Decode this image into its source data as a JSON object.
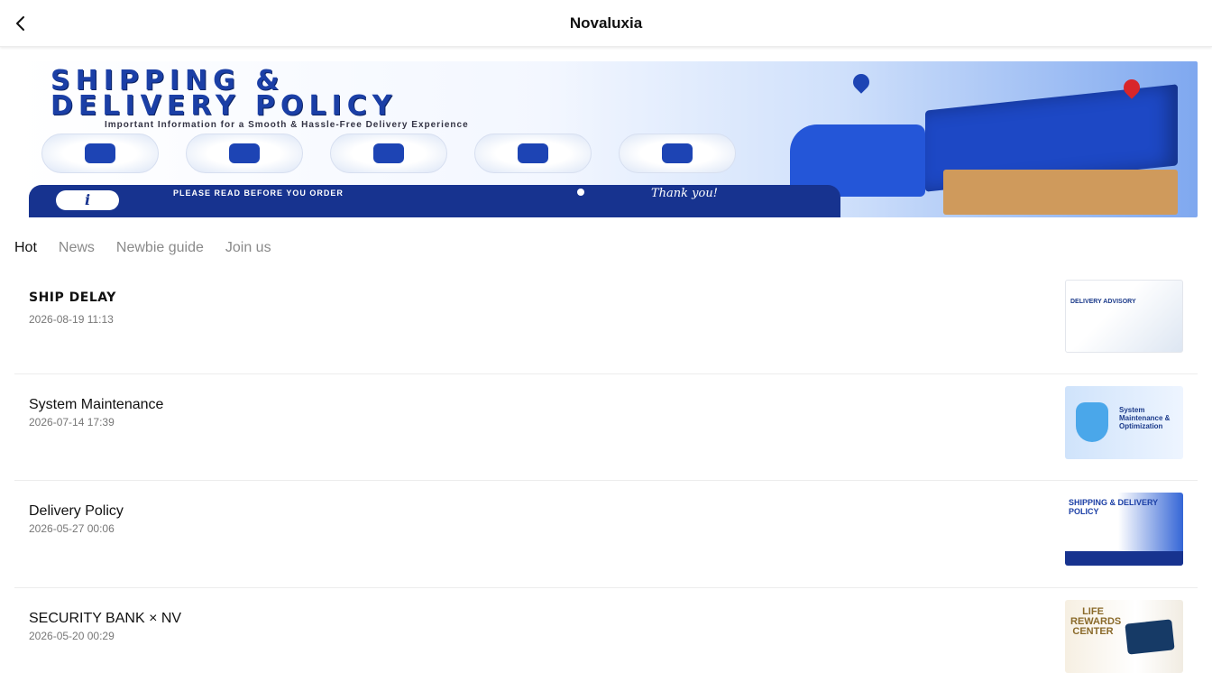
{
  "header": {
    "title": "Novaluxia",
    "back_icon": "chevron-left-icon"
  },
  "banner": {
    "headline_line1": "SHIPPING &",
    "headline_line2": "DELIVERY POLICY",
    "subtitle": "Important Information for a Smooth & Hassle-Free Delivery Experience",
    "notice": "PLEASE READ BEFORE YOU ORDER",
    "thanks": "Thank you!",
    "info_symbol": "i"
  },
  "tabs": [
    {
      "label": "Hot",
      "active": true
    },
    {
      "label": "News",
      "active": false
    },
    {
      "label": "Newbie guide",
      "active": false
    },
    {
      "label": "Join us",
      "active": false
    }
  ],
  "articles": [
    {
      "title": "SHIP DELAY",
      "date": "2026-08-19 11:13",
      "thumb_text": "DELIVERY ADVISORY"
    },
    {
      "title": "System Maintenance",
      "date": "2026-07-14 17:39",
      "thumb_text": "System Maintenance & Optimization"
    },
    {
      "title": "Delivery Policy",
      "date": "2026-05-27 00:06",
      "thumb_text": "SHIPPING & DELIVERY POLICY"
    },
    {
      "title": "SECURITY BANK × NV",
      "date": "2026-05-20 00:29",
      "thumb_text": "LIFE REWARDS CENTER"
    }
  ]
}
